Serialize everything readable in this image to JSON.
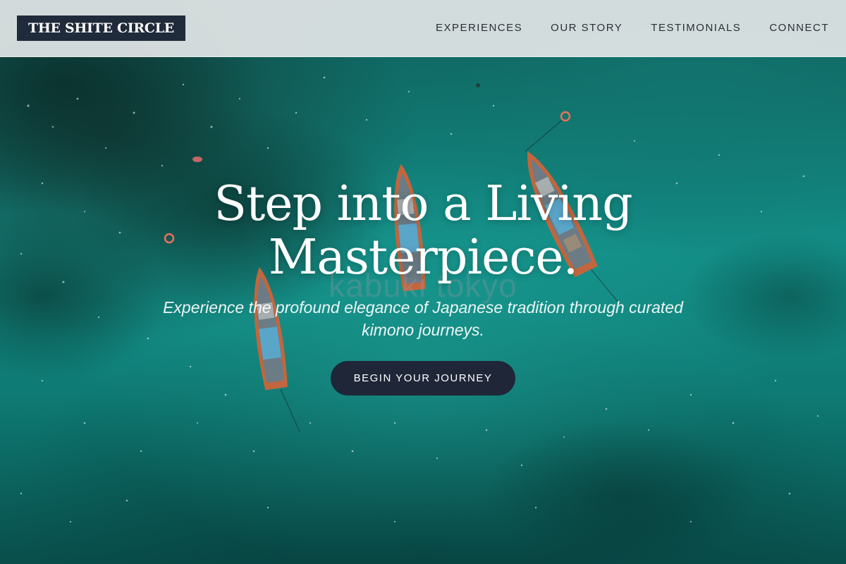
{
  "header": {
    "logo_text": "THE SHITE CIRCLE",
    "nav": [
      {
        "label": "EXPERIENCES"
      },
      {
        "label": "OUR STORY"
      },
      {
        "label": "TESTIMONIALS"
      },
      {
        "label": "CONNECT"
      }
    ]
  },
  "hero": {
    "title_line1": "Step into a Living",
    "title_line2": "Masterpiece.",
    "watermark": "kabuki tokyo",
    "subtitle_line1": "Experience the profound elegance of Japanese tradition through curated",
    "subtitle_line2": "kimono journeys.",
    "cta_label": "BEGIN YOUR JOURNEY"
  },
  "colors": {
    "header_bg": "#e2e5e6",
    "logo_bg": "#1f2a3a",
    "cta_bg": "#1f2638",
    "sea": "#138e87"
  }
}
